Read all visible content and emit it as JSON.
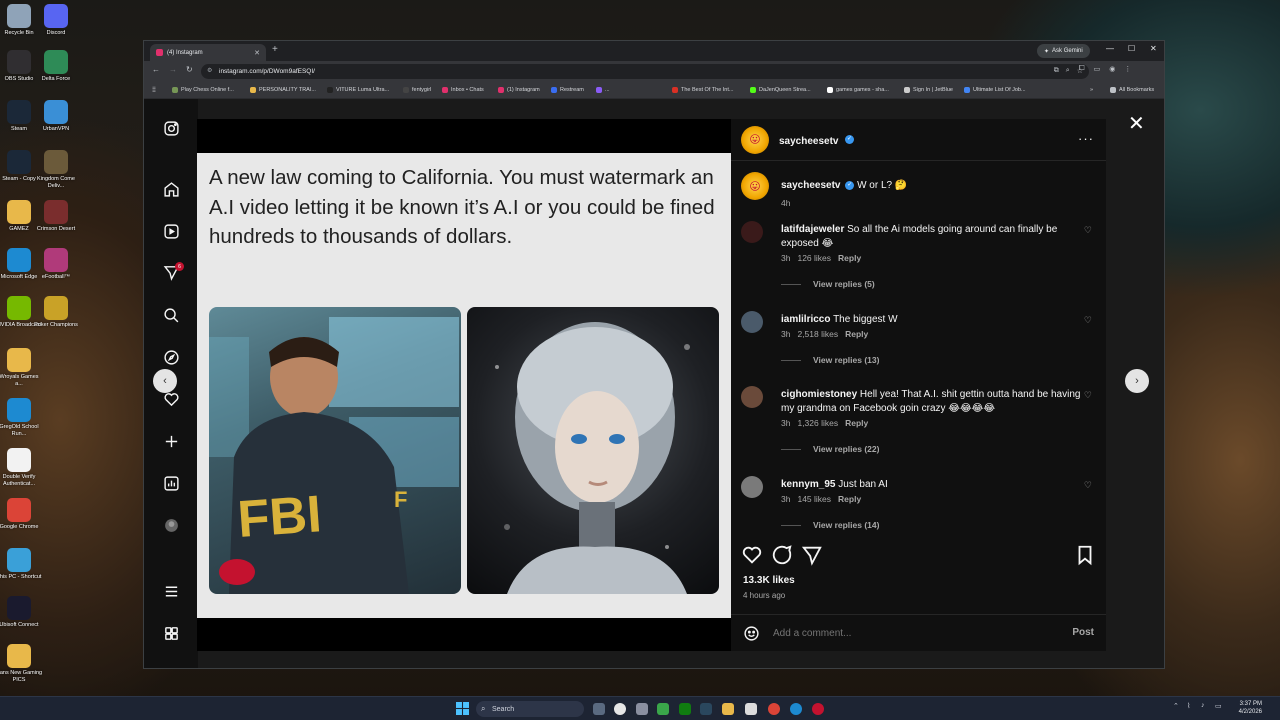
{
  "desktop": {
    "icons": [
      {
        "label": "Recycle Bin",
        "icon": "recycle-bin-icon",
        "color": "#8fa3b8"
      },
      {
        "label": "Discord",
        "icon": "discord-icon",
        "color": "#5865f2"
      },
      {
        "label": "OBS Studio",
        "icon": "obs-icon",
        "color": "#302e31"
      },
      {
        "label": "Delta Force",
        "icon": "delta-force-icon",
        "color": "#2e8b57"
      },
      {
        "label": "Steam",
        "icon": "steam-icon",
        "color": "#1b2838"
      },
      {
        "label": "UrbanVPN",
        "icon": "vpn-icon",
        "color": "#3a8fd6"
      },
      {
        "label": "Steam - Copy",
        "icon": "steam-icon",
        "color": "#1b2838"
      },
      {
        "label": "Kingdom Come Deliv...",
        "icon": "game-icon",
        "color": "#6b5a3a"
      },
      {
        "label": "GAMEZ",
        "icon": "folder-icon",
        "color": "#e8b84a"
      },
      {
        "label": "Crimson Desert",
        "icon": "game-icon",
        "color": "#7a2d2d"
      },
      {
        "label": "Microsoft Edge",
        "icon": "edge-icon",
        "color": "#1d8ad1"
      },
      {
        "label": "eFootball™",
        "icon": "game-icon",
        "color": "#b03a7a"
      },
      {
        "label": "NVIDIA Broadcast",
        "icon": "nvidia-icon",
        "color": "#76b900"
      },
      {
        "label": "Poker Champions",
        "icon": "game-icon",
        "color": "#c9a227"
      },
      {
        "label": "Wroyals Games a...",
        "icon": "folder-icon",
        "color": "#e8b84a"
      },
      {
        "label": "GregOld School Run...",
        "icon": "edge-icon",
        "color": "#1d8ad1"
      },
      {
        "label": "Double Verify Authenticat...",
        "icon": "file-icon",
        "color": "#f2f2f2"
      },
      {
        "label": "Google Chrome",
        "icon": "chrome-icon",
        "color": "#db4437"
      },
      {
        "label": "This PC - Shortcut",
        "icon": "pc-icon",
        "color": "#3aa0d8"
      },
      {
        "label": "Ubisoft Connect",
        "icon": "ubisoft-icon",
        "color": "#1a1a2e"
      },
      {
        "label": "Dans New Gaming PICS",
        "icon": "folder-icon",
        "color": "#e8b84a"
      }
    ]
  },
  "browser": {
    "tab_title": "(4) Instagram",
    "ask_gemini": "Ask Gemini",
    "url": "instagram.com/p/DWom9afESQI/",
    "bookmarks": [
      {
        "label": "Play Chess Online f...",
        "color": "#769656"
      },
      {
        "label": "PERSONALITY TRAI...",
        "color": "#e8b84a"
      },
      {
        "label": "VITURE Luma Ultra...",
        "color": "#222222"
      },
      {
        "label": "fentygirl",
        "color": "#444444"
      },
      {
        "label": "Inbox • Chats",
        "color": "#e1306c"
      },
      {
        "label": "(1) Instagram",
        "color": "#e1306c"
      },
      {
        "label": "Restream",
        "color": "#3a6df0"
      },
      {
        "label": "...",
        "color": "#8a5cf6"
      },
      {
        "label": "The Best Of The Int...",
        "color": "#d93025"
      },
      {
        "label": "DaJenQueen Strea...",
        "color": "#53fc18"
      },
      {
        "label": "games games - sha...",
        "color": "#ffffff"
      },
      {
        "label": "Sign In | JetBlue",
        "color": "#cccccc"
      },
      {
        "label": "Ultimate List Of Job...",
        "color": "#4285f4"
      }
    ],
    "all_bookmarks": "All Bookmarks"
  },
  "post": {
    "caption_image_text": "A new law coming to California. You must watermark an A.I video letting it be known it’s A.I or you could be fined hundreds to thousands of dollars.",
    "author": "saycheesetv",
    "author_caption": "W or L? 🤔",
    "author_time": "4h",
    "comments": [
      {
        "user": "latifdajeweler",
        "text": "So all the Ai models going around can finally be exposed 😂",
        "time": "3h",
        "likes": "126 likes",
        "reply": "Reply",
        "view_replies": "View replies (5)",
        "avatar_color": "#3a1a1a"
      },
      {
        "user": "iamlilricco",
        "text": "The biggest W",
        "time": "3h",
        "likes": "2,518 likes",
        "reply": "Reply",
        "view_replies": "View replies (13)",
        "avatar_color": "#4a5a6a"
      },
      {
        "user": "cighomiestoney",
        "text": "Hell yea! That A.I. shit gettin outta hand be having my grandma on Facebook goin crazy 😂😂😂😂",
        "time": "3h",
        "likes": "1,326 likes",
        "reply": "Reply",
        "view_replies": "View replies (22)",
        "avatar_color": "#6a4a3a"
      },
      {
        "user": "kennym_95",
        "text": "Just ban AI",
        "time": "3h",
        "likes": "145 likes",
        "reply": "Reply",
        "view_replies": "View replies (14)",
        "avatar_color": "#7a7a7a"
      }
    ],
    "likes": "13.3K likes",
    "posted_ago": "4 hours ago",
    "add_comment_placeholder": "Add a comment...",
    "post_button": "Post"
  },
  "taskbar": {
    "search": "Search",
    "time": "3:37 PM",
    "date": "4/2/2026"
  },
  "colors": {
    "instagram_accent": "#e1306c",
    "verified": "#3897f0",
    "notification": "#c4122f"
  }
}
